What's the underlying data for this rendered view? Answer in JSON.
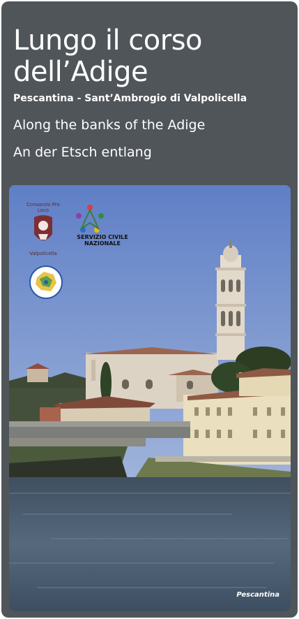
{
  "header": {
    "title_line1": "Lungo il corso",
    "title_line2": "dell’Adige",
    "subtitle": "Pescantina - Sant’Ambrogio di Valpolicella",
    "tagline_en": "Along the banks of the Adige",
    "tagline_de": "An der Etsch entlang"
  },
  "photo": {
    "caption": "Pescantina",
    "logos": {
      "proloco_top": "Consorzio Pro Loco",
      "proloco_bottom": "Valpolicella",
      "servizio_line1": "SERVIZIO CIVILE",
      "servizio_line2": "NAZIONALE"
    }
  },
  "colors": {
    "card_bg": "#50555a",
    "sky": "#6e8bcc",
    "water": "#4a5a6b",
    "text": "#ffffff"
  }
}
